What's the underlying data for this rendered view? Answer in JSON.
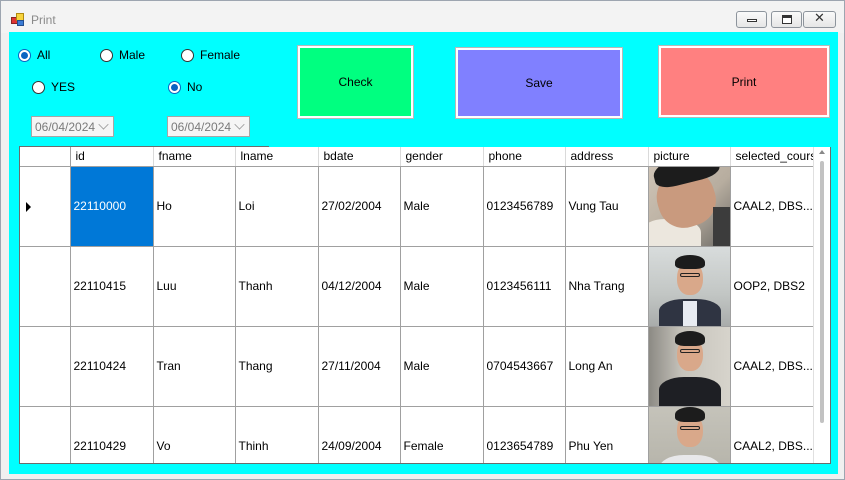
{
  "window": {
    "title": "Print"
  },
  "filters": {
    "gender": {
      "all": "All",
      "male": "Male",
      "female": "Female"
    },
    "yesno": {
      "yes": "YES",
      "no": "No"
    },
    "date_from": "06/04/2024",
    "date_to": "06/04/2024"
  },
  "buttons": {
    "check": "Check",
    "save": "Save",
    "print": "Print"
  },
  "colors": {
    "client_bg": "#00ffff",
    "check_btn": "#00ff80",
    "save_btn": "#8080ff",
    "print_btn": "#ff8080",
    "selection": "#0078d7"
  },
  "grid": {
    "columns": [
      "id",
      "fname",
      "lname",
      "bdate",
      "gender",
      "phone",
      "address",
      "picture",
      "selected_course"
    ],
    "rows": [
      {
        "id": "22110000",
        "fname": "Ho",
        "lname": "Loi",
        "bdate": "27/02/2004",
        "gender": "Male",
        "phone": "0123456789",
        "address": "Vung Tau",
        "picture": "photo-icon",
        "selected_course": "CAAL2, DBS..."
      },
      {
        "id": "22110415",
        "fname": "Luu",
        "lname": "Thanh",
        "bdate": "04/12/2004",
        "gender": "Male",
        "phone": "0123456111",
        "address": "Nha Trang",
        "picture": "photo-icon",
        "selected_course": "OOP2, DBS2"
      },
      {
        "id": "22110424",
        "fname": "Tran",
        "lname": "Thang",
        "bdate": "27/11/2004",
        "gender": "Male",
        "phone": "0704543667",
        "address": "Long An",
        "picture": "photo-icon",
        "selected_course": "CAAL2, DBS..."
      },
      {
        "id": "22110429",
        "fname": "Vo",
        "lname": "Thinh",
        "bdate": "24/09/2004",
        "gender": "Female",
        "phone": "0123654789",
        "address": "Phu Yen",
        "picture": "photo-icon",
        "selected_course": "CAAL2, DBS..."
      }
    ]
  }
}
